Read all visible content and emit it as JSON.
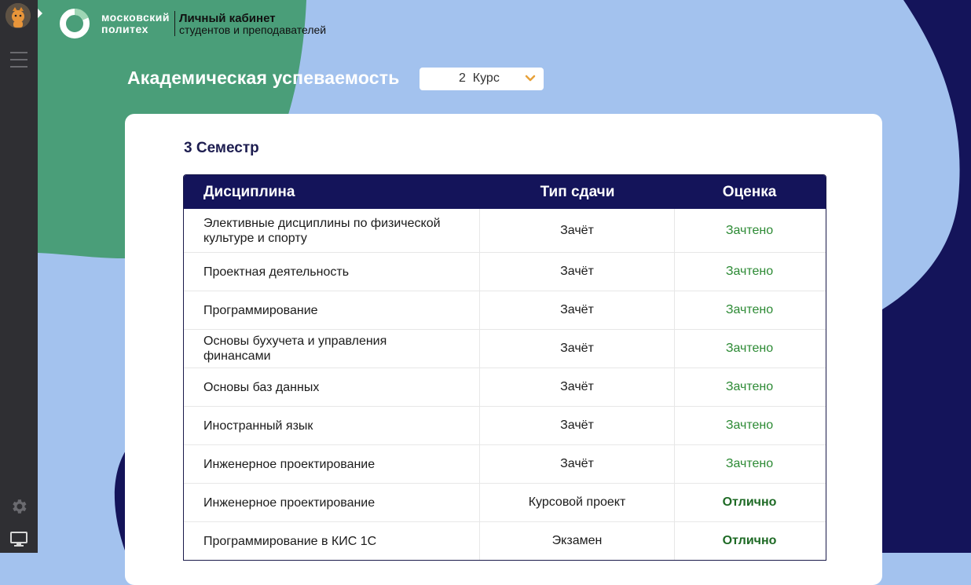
{
  "brand": {
    "name_line1": "московский",
    "name_line2": "политех",
    "cabinet_title": "Личный кабинет",
    "cabinet_subtitle": "студентов и преподавателей"
  },
  "page": {
    "title": "Академическая успеваемость",
    "course_select": {
      "value": "2  Курс"
    }
  },
  "semester": {
    "title": "3 Семестр",
    "columns": [
      "Дисциплина",
      "Тип сдачи",
      "Оценка"
    ],
    "rows": [
      {
        "discipline": "Элективные дисциплины по физической культуре и спорту",
        "type": "Зачёт",
        "grade": "Зачтено"
      },
      {
        "discipline": "Проектная деятельность",
        "type": "Зачёт",
        "grade": "Зачтено"
      },
      {
        "discipline": "Программирование",
        "type": "Зачёт",
        "grade": "Зачтено"
      },
      {
        "discipline": "Основы бухучета и управления финансами",
        "type": "Зачёт",
        "grade": "Зачтено"
      },
      {
        "discipline": "Основы баз данных",
        "type": "Зачёт",
        "grade": "Зачтено"
      },
      {
        "discipline": "Иностранный язык",
        "type": "Зачёт",
        "grade": "Зачтено"
      },
      {
        "discipline": "Инженерное проектирование",
        "type": "Зачёт",
        "grade": "Зачтено"
      },
      {
        "discipline": "Инженерное проектирование",
        "type": "Курсовой проект",
        "grade": "Отлично"
      },
      {
        "discipline": "Программирование в КИС 1С",
        "type": "Экзамен",
        "grade": "Отлично"
      }
    ]
  },
  "colors": {
    "background_blue": "#a3c2ee",
    "navy": "#14145a",
    "green_blob": "#4a9e79",
    "passed_green": "#2c8a34",
    "excellent_green": "#1e6a25"
  }
}
